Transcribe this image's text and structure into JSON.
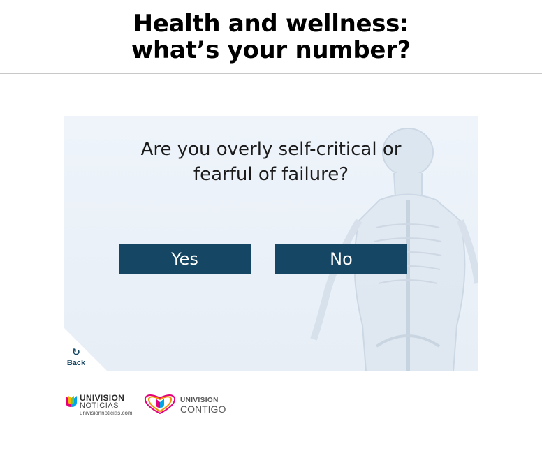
{
  "header": {
    "title_line1": "Health and wellness:",
    "title_line2": "what’s your number?"
  },
  "quiz": {
    "question_line1": "Are you overly self-critical or",
    "question_line2": "fearful of failure?",
    "yes_label": "Yes",
    "no_label": "No",
    "back_label": "Back"
  },
  "footer": {
    "logo1": {
      "brand": "UNIVISION",
      "sub": "NOTICIAS",
      "url": "univisionnoticias.com"
    },
    "logo2": {
      "brand": "UNIVISION",
      "sub": "CONTIGO"
    }
  },
  "colors": {
    "button_bg": "#154663",
    "panel_bg": "#eef4fa"
  }
}
